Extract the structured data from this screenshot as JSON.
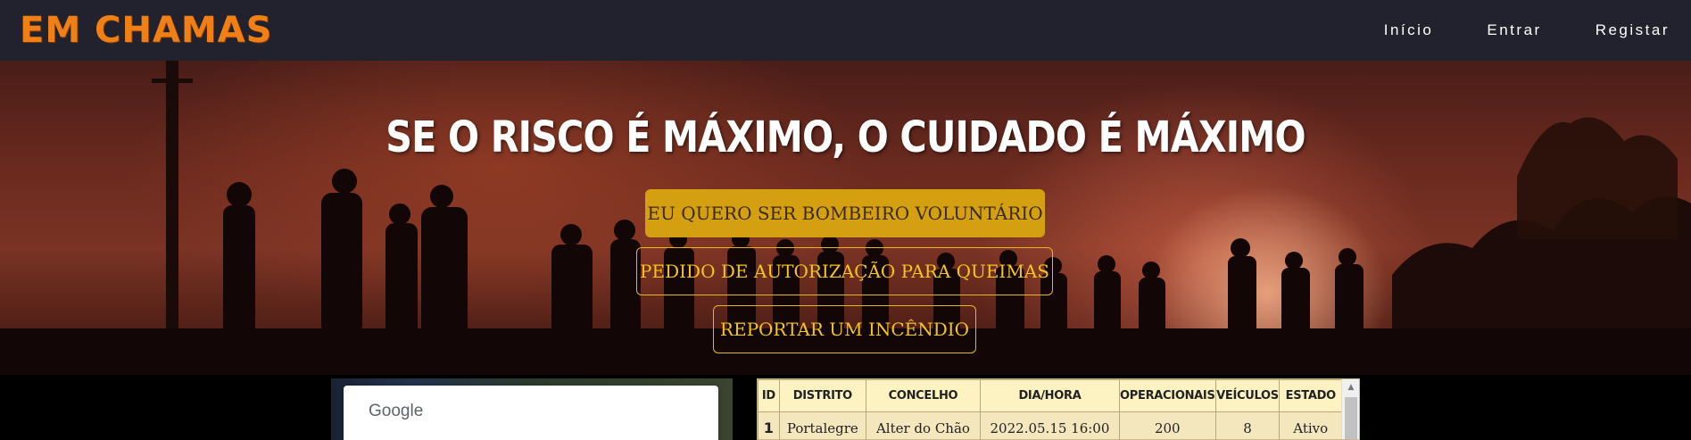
{
  "brand": "EM CHAMAS",
  "nav": {
    "items": [
      {
        "label": "Início"
      },
      {
        "label": "Entrar"
      },
      {
        "label": "Registar"
      }
    ]
  },
  "hero": {
    "title": "SE O RISCO É MÁXIMO, O CUIDADO É MÁXIMO",
    "buttons": [
      {
        "label": "EU QUERO SER BOMBEIRO VOLUNTÁRIO",
        "style": "filled"
      },
      {
        "label": "PEDIDO DE AUTORIZAÇÃO PARA QUEIMAS",
        "style": "outline"
      },
      {
        "label": "REPORTAR UM INCÊNDIO",
        "style": "outline"
      }
    ]
  },
  "map": {
    "provider_label": "Google"
  },
  "incidents_table": {
    "headers": [
      "ID",
      "DISTRITO",
      "CONCELHO",
      "DIA/HORA",
      "OPERACIONAIS",
      "VEÍCULOS",
      "ESTADO"
    ],
    "rows": [
      [
        "1",
        "Portalegre",
        "Alter do Chão",
        "2022.05.15 16:00",
        "200",
        "8",
        "Ativo"
      ]
    ]
  },
  "colors": {
    "navbar_bg": "#21222e",
    "brand": "#f07f16",
    "cta_primary_bg": "#d4a011",
    "cta_outline": "#f5c518",
    "table_bg": "#fbefc9"
  }
}
